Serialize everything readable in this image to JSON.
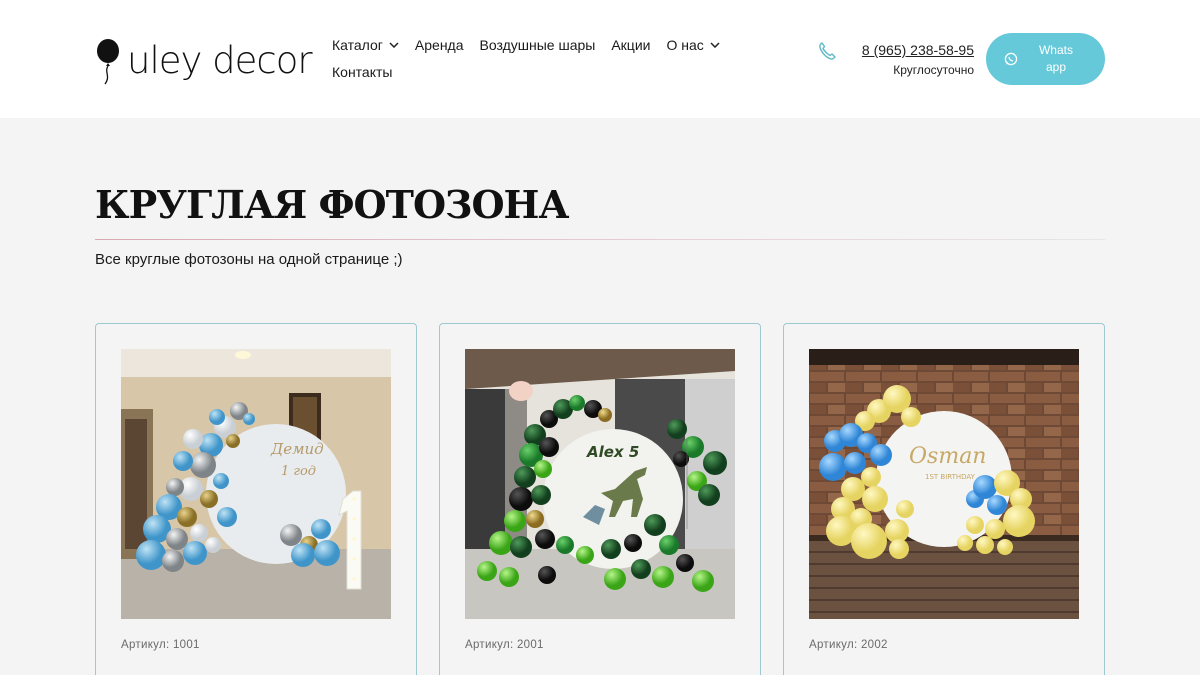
{
  "header": {
    "logo_text": "uley decor",
    "nav": {
      "row1": [
        {
          "label": "Каталог",
          "has_dropdown": true
        },
        {
          "label": "Аренда",
          "has_dropdown": false
        },
        {
          "label": "Воздушные шары",
          "has_dropdown": false
        },
        {
          "label": "Акции",
          "has_dropdown": false
        },
        {
          "label": "О нас",
          "has_dropdown": true
        }
      ],
      "row2": [
        {
          "label": "Контакты",
          "has_dropdown": false
        }
      ]
    },
    "phone": {
      "number": "8 (965) 238-58-95",
      "hours": "Круглосуточно",
      "icon": "phone-icon"
    },
    "whatsapp": {
      "label": "Whats app",
      "icon": "whatsapp-icon",
      "color": "#66c9d9"
    }
  },
  "main": {
    "title": "КРУГЛАЯ ФОТОЗОНА",
    "subtitle": "Все круглые фотозоны на одной странице ;)"
  },
  "products": [
    {
      "sku": "Артикул: 1001",
      "photo_alt": "Фотозона с голубыми, белыми и серебряными шарами"
    },
    {
      "sku": "Артикул: 2001",
      "photo_alt": "Фотозона с зелёными шарами и динозаврами"
    },
    {
      "sku": "Артикул: 2002",
      "photo_alt": "Фотозона с жёлтыми и голубыми шарами"
    }
  ],
  "colors": {
    "accent": "#66c9d9",
    "card_border": "#9ec9cf",
    "background": "#f4f4f4"
  }
}
